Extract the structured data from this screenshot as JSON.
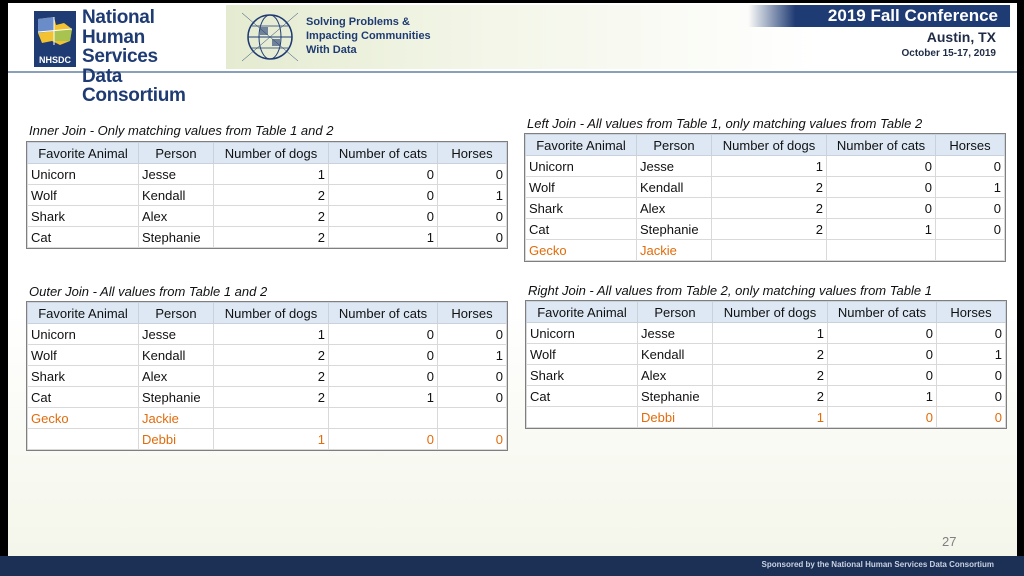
{
  "header": {
    "org_lines": [
      "National",
      "Human Services",
      "Data Consortium"
    ],
    "org_abbr": "NHSDC",
    "tagline": [
      "Solving Problems &",
      "Impacting Communities",
      "With Data"
    ],
    "conference_title": "2019 Fall Conference",
    "city": "Austin, TX",
    "dates": "October 15-17, 2019"
  },
  "columns": [
    "Favorite Animal",
    "Person",
    "Number of dogs",
    "Number of cats",
    "Horses"
  ],
  "tables": {
    "inner": {
      "caption": "Inner Join - Only matching values from Table 1 and 2",
      "rows": [
        {
          "animal": "Unicorn",
          "person": "Jesse",
          "dogs": "1",
          "cats": "0",
          "horses": "0"
        },
        {
          "animal": "Wolf",
          "person": "Kendall",
          "dogs": "2",
          "cats": "0",
          "horses": "1"
        },
        {
          "animal": "Shark",
          "person": "Alex",
          "dogs": "2",
          "cats": "0",
          "horses": "0"
        },
        {
          "animal": "Cat",
          "person": "Stephanie",
          "dogs": "2",
          "cats": "1",
          "horses": "0"
        }
      ]
    },
    "left": {
      "caption": "Left Join - All values from Table 1, only matching values from Table 2",
      "rows": [
        {
          "animal": "Unicorn",
          "person": "Jesse",
          "dogs": "1",
          "cats": "0",
          "horses": "0"
        },
        {
          "animal": "Wolf",
          "person": "Kendall",
          "dogs": "2",
          "cats": "0",
          "horses": "1"
        },
        {
          "animal": "Shark",
          "person": "Alex",
          "dogs": "2",
          "cats": "0",
          "horses": "0"
        },
        {
          "animal": "Cat",
          "person": "Stephanie",
          "dogs": "2",
          "cats": "1",
          "horses": "0"
        },
        {
          "animal": "Gecko",
          "person": "Jackie",
          "dogs": "",
          "cats": "",
          "horses": "",
          "highlight": true
        }
      ]
    },
    "outer": {
      "caption": "Outer Join - All values from Table 1 and 2",
      "rows": [
        {
          "animal": "Unicorn",
          "person": "Jesse",
          "dogs": "1",
          "cats": "0",
          "horses": "0"
        },
        {
          "animal": "Wolf",
          "person": "Kendall",
          "dogs": "2",
          "cats": "0",
          "horses": "1"
        },
        {
          "animal": "Shark",
          "person": "Alex",
          "dogs": "2",
          "cats": "0",
          "horses": "0"
        },
        {
          "animal": "Cat",
          "person": "Stephanie",
          "dogs": "2",
          "cats": "1",
          "horses": "0"
        },
        {
          "animal": "Gecko",
          "person": "Jackie",
          "dogs": "",
          "cats": "",
          "horses": "",
          "highlight": true
        },
        {
          "animal": "",
          "person": "Debbi",
          "dogs": "1",
          "cats": "0",
          "horses": "0",
          "highlight": true
        }
      ]
    },
    "right": {
      "caption": "Right Join - All values from Table 2, only matching values from Table 1",
      "rows": [
        {
          "animal": "Unicorn",
          "person": "Jesse",
          "dogs": "1",
          "cats": "0",
          "horses": "0"
        },
        {
          "animal": "Wolf",
          "person": "Kendall",
          "dogs": "2",
          "cats": "0",
          "horses": "1"
        },
        {
          "animal": "Shark",
          "person": "Alex",
          "dogs": "2",
          "cats": "0",
          "horses": "0"
        },
        {
          "animal": "Cat",
          "person": "Stephanie",
          "dogs": "2",
          "cats": "1",
          "horses": "0"
        },
        {
          "animal": "",
          "person": "Debbi",
          "dogs": "1",
          "cats": "0",
          "horses": "0",
          "highlight": true
        }
      ]
    }
  },
  "colors": {
    "highlight": "#e26b0a",
    "brand_navy": "#1f3b73",
    "header_fill": "#dde8f4"
  },
  "footer": {
    "sponsor": "Sponsored by the National Human Services Data Consortium"
  },
  "slide_number": "27"
}
